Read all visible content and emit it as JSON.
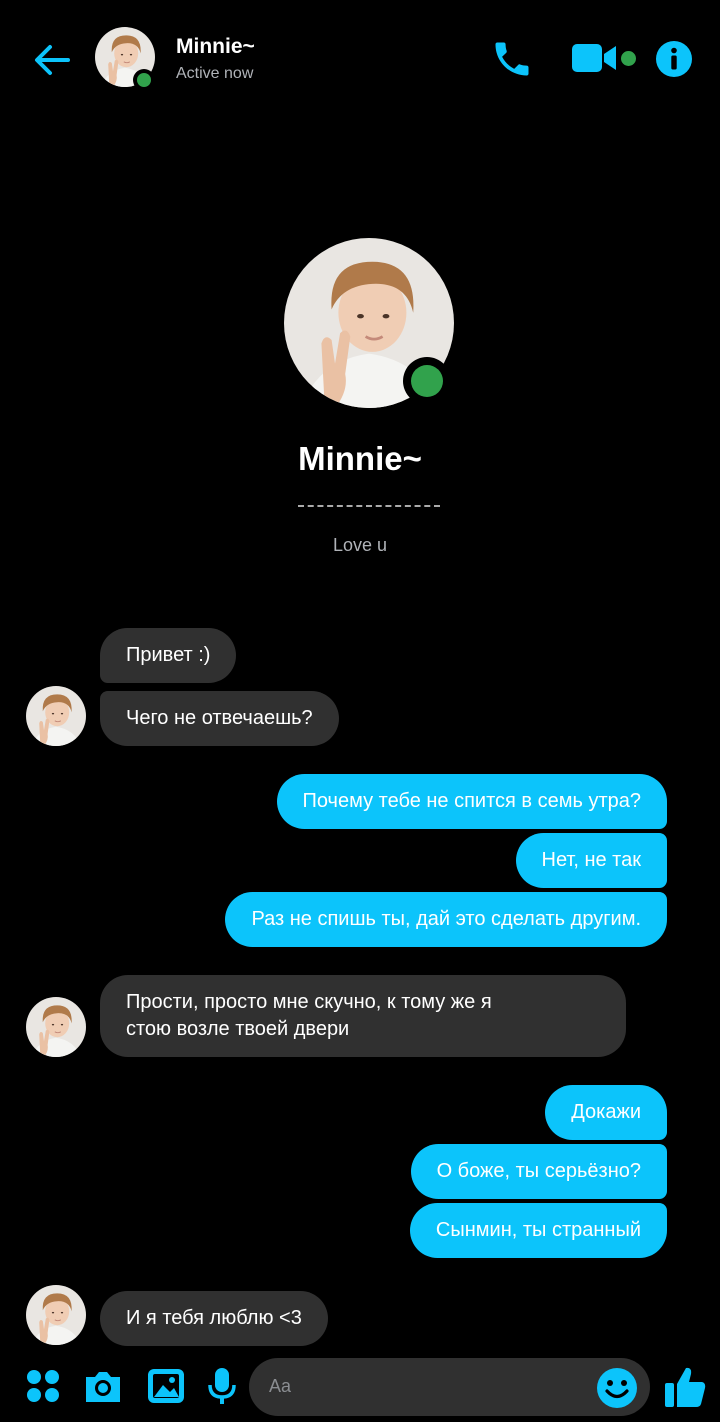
{
  "header": {
    "contact_name": "Minnie~",
    "status": "Active now"
  },
  "profile": {
    "name": "Minnie~",
    "bio": "Love u"
  },
  "messages": [
    {
      "side": "in",
      "text": "Привет :)"
    },
    {
      "side": "in",
      "text": "Чего не отвечаешь?"
    },
    {
      "side": "out",
      "text": "Почему тебе не спится в семь утра?"
    },
    {
      "side": "out",
      "text": "Нет, не так"
    },
    {
      "side": "out",
      "text": "Раз не спишь ты, дай это сделать другим."
    },
    {
      "side": "in",
      "text": "Прости, просто мне скучно, к тому же я\nстою возле твоей двери"
    },
    {
      "side": "out",
      "text": "Докажи"
    },
    {
      "side": "out",
      "text": "О боже, ты серьёзно?"
    },
    {
      "side": "out",
      "text": "Сынмин, ты странный"
    },
    {
      "side": "in",
      "text": "И я тебя люблю <3"
    }
  ],
  "composer": {
    "placeholder": "Aa"
  },
  "icons": {
    "back": "arrow-left-icon",
    "phone": "phone-icon",
    "video": "video-camera-icon",
    "info": "info-icon",
    "menu": "four-dots-icon",
    "camera": "camera-icon",
    "gallery": "image-icon",
    "mic": "microphone-icon",
    "emoji": "smiley-icon",
    "like": "thumbs-up-icon"
  },
  "colors": {
    "accent": "#0cc4fb",
    "online": "#31a24c",
    "incoming_bubble": "#303030",
    "background": "#000000"
  }
}
